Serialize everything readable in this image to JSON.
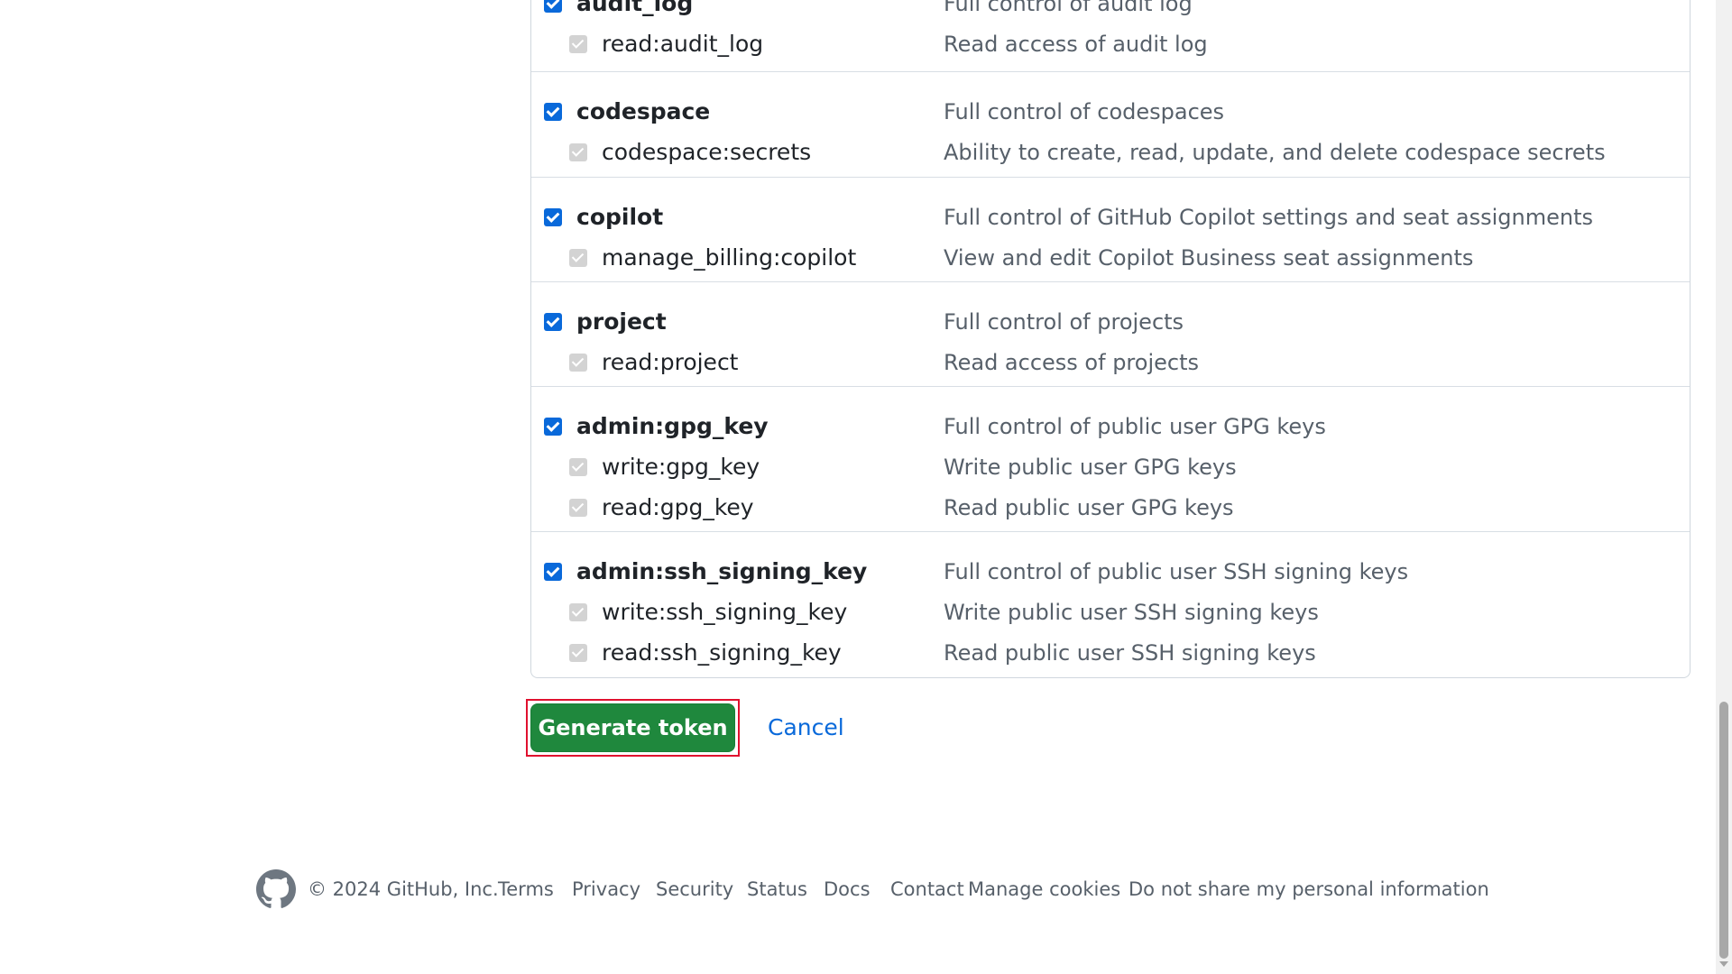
{
  "scopes": [
    {
      "name": "audit_log",
      "description": "Full control of audit log",
      "subs": [
        {
          "name": "read:audit_log",
          "description": "Read access of audit log"
        }
      ]
    },
    {
      "name": "codespace",
      "description": "Full control of codespaces",
      "subs": [
        {
          "name": "codespace:secrets",
          "description": "Ability to create, read, update, and delete codespace secrets"
        }
      ]
    },
    {
      "name": "copilot",
      "description": "Full control of GitHub Copilot settings and seat assignments",
      "subs": [
        {
          "name": "manage_billing:copilot",
          "description": "View and edit Copilot Business seat assignments"
        }
      ]
    },
    {
      "name": "project",
      "description": "Full control of projects",
      "subs": [
        {
          "name": "read:project",
          "description": "Read access of projects"
        }
      ]
    },
    {
      "name": "admin:gpg_key",
      "description": "Full control of public user GPG keys",
      "subs": [
        {
          "name": "write:gpg_key",
          "description": "Write public user GPG keys"
        },
        {
          "name": "read:gpg_key",
          "description": "Read public user GPG keys"
        }
      ]
    },
    {
      "name": "admin:ssh_signing_key",
      "description": "Full control of public user SSH signing keys",
      "subs": [
        {
          "name": "write:ssh_signing_key",
          "description": "Write public user SSH signing keys"
        },
        {
          "name": "read:ssh_signing_key",
          "description": "Read public user SSH signing keys"
        }
      ]
    }
  ],
  "actions": {
    "generate_label": "Generate token",
    "cancel_label": "Cancel"
  },
  "footer": {
    "logo_icon": "github-mark-icon",
    "copyright": "© 2024 GitHub, Inc.",
    "links": [
      "Terms",
      "Privacy",
      "Security",
      "Status",
      "Docs",
      "Contact",
      "Manage cookies",
      "Do not share my personal information"
    ]
  },
  "colors": {
    "checkbox_checked": "#0969da",
    "checkbox_disabled": "#d3d3d3",
    "primary_button": "#1f883d",
    "highlight_border": "#e0102e",
    "link": "#0969da"
  }
}
